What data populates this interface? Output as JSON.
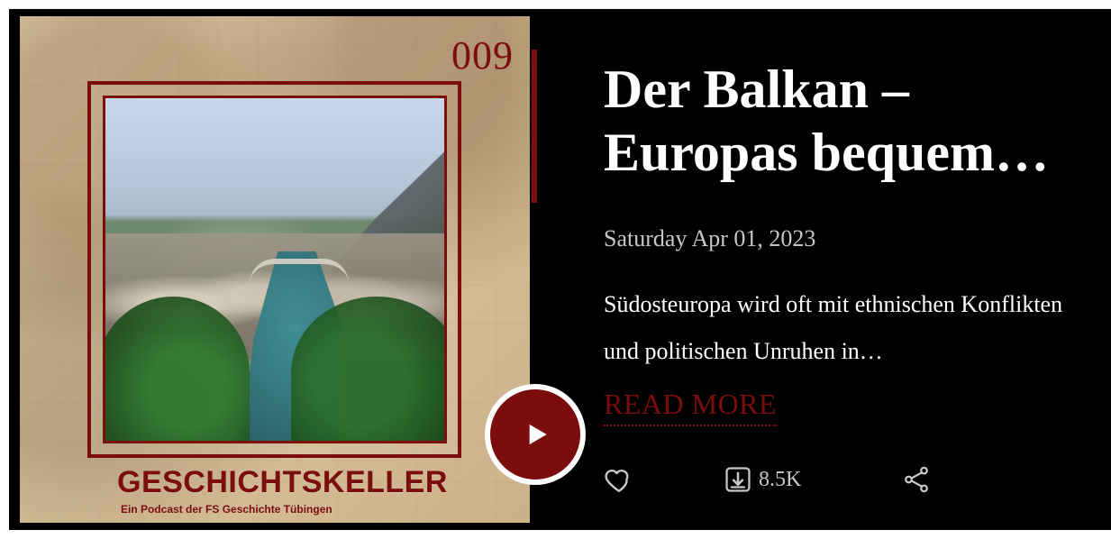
{
  "episode": {
    "number": "009",
    "title": "Der Balkan – Europas bequem…",
    "date": "Saturday Apr 01, 2023",
    "description": "Südosteuropa wird oft mit ethnischen Konflikten und politischen Unruhen in…",
    "read_more_label": "READ MORE",
    "downloads": "8.5K"
  },
  "branding": {
    "podcast_title": "GESCHICHTSKELLER",
    "podcast_subtitle": "Ein Podcast der FS Geschichte Tübingen"
  },
  "icons": {
    "like": "heart-icon",
    "download": "download-icon",
    "share": "share-icon",
    "play": "play-icon"
  },
  "colors": {
    "brand_red": "#7b0d0d",
    "background": "#000000",
    "text": "#ffffff",
    "muted_text": "#c7c7c7"
  }
}
